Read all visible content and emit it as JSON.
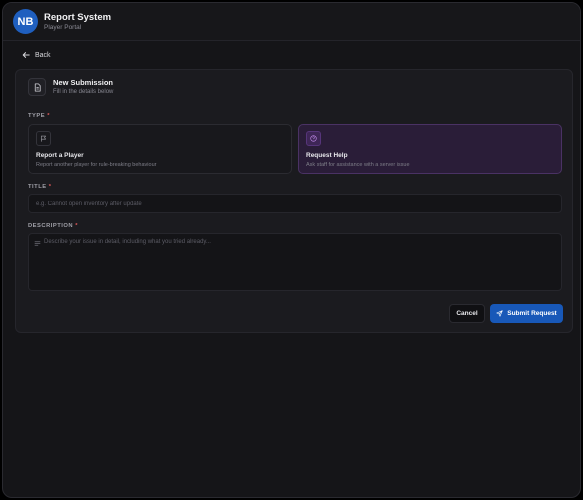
{
  "header": {
    "avatar_initials": "NB",
    "title": "Report System",
    "subtitle": "Player Portal"
  },
  "nav": {
    "back_label": "Back"
  },
  "form": {
    "title": "New Submission",
    "subtitle": "Fill in the details below",
    "type_label": "TYPE",
    "options": [
      {
        "title": "Report a Player",
        "description": "Report another player for rule-breaking behaviour",
        "icon": "flag-icon",
        "selected": false
      },
      {
        "title": "Request Help",
        "description": "Ask staff for assistance with a server issue",
        "icon": "help-circle-icon",
        "selected": true
      }
    ],
    "title_field_label": "TITLE",
    "title_placeholder": "e.g. Cannot open inventory after update",
    "title_value": "",
    "description_label": "DESCRIPTION",
    "description_placeholder": "Describe your issue in detail, including what you tried already...",
    "description_value": "",
    "required_marker": "*"
  },
  "actions": {
    "cancel_label": "Cancel",
    "submit_label": "Submit Request"
  },
  "colors": {
    "accent": "#1858b8",
    "selected_bg": "#2a1d38",
    "required": "#e05a5a"
  }
}
